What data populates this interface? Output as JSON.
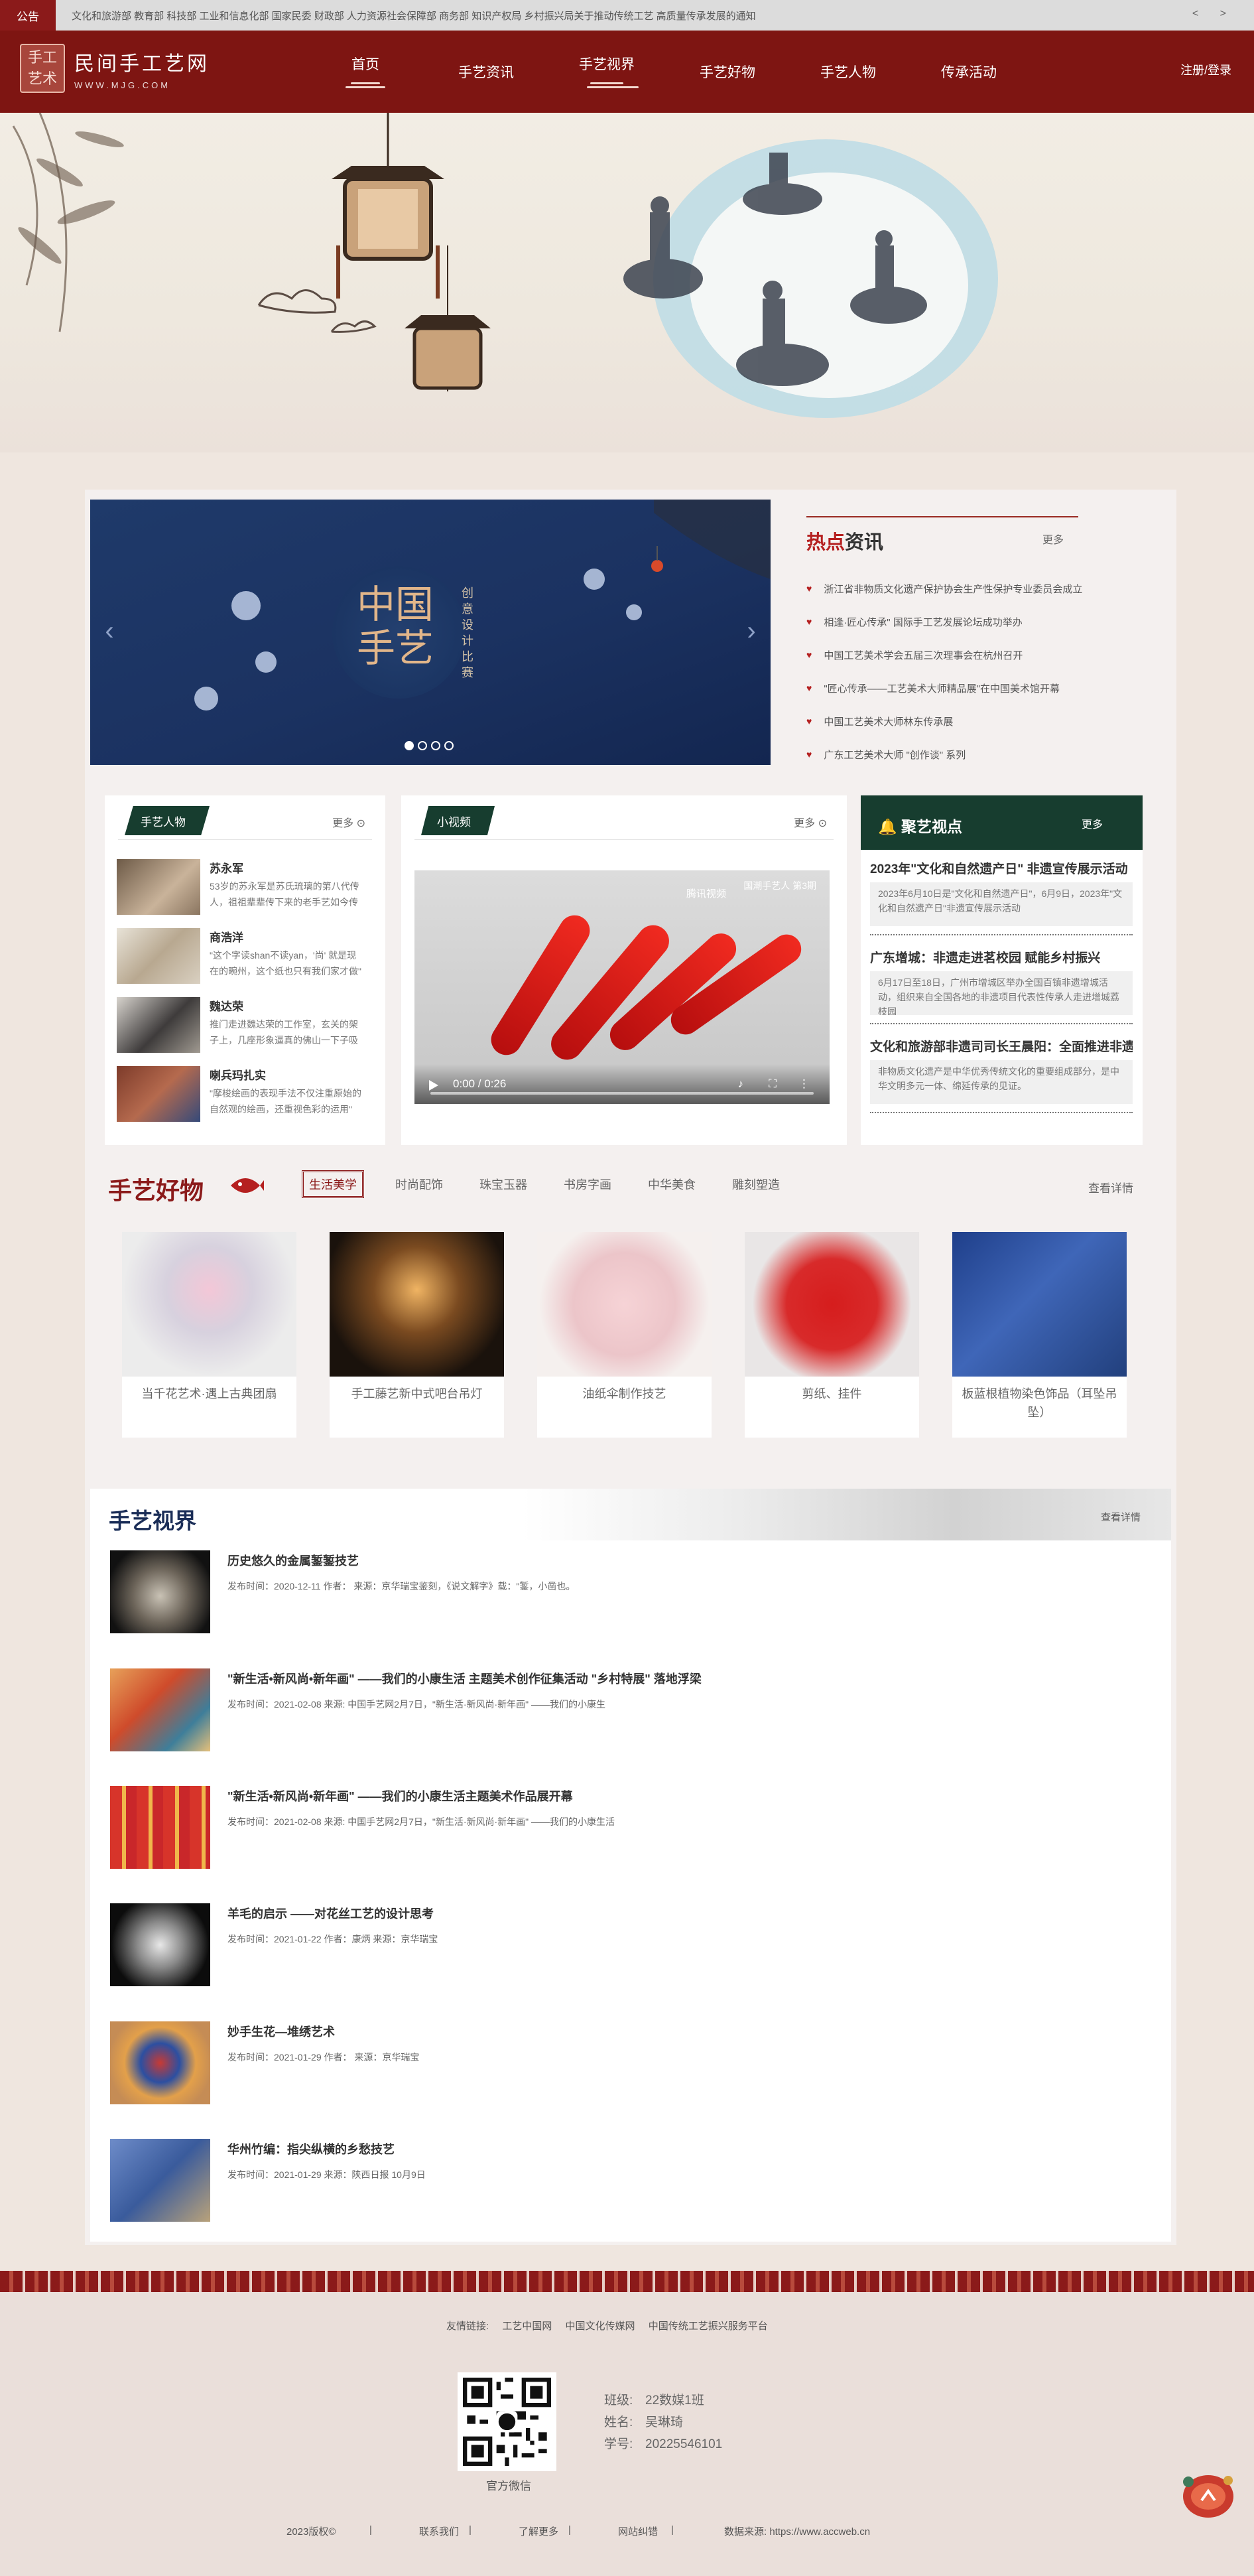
{
  "notice": {
    "tag": "公告",
    "text": "文化和旅游部 教育部 科技部 工业和信息化部 国家民委 财政部 人力资源社会保障部 商务部 知识产权局 乡村振兴局关于推动传统工艺 高质量传承发展的通知",
    "arrows": "< >"
  },
  "header": {
    "logo_seal": "手工 艺术",
    "logo_name": "民间手工艺网",
    "logo_url": "WWW.MJG.COM",
    "nav": [
      "首页",
      "手艺资讯",
      "手艺视界",
      "手艺好物",
      "手艺人物",
      "传承活动"
    ],
    "login": "注册/登录"
  },
  "banner": {
    "title": "中国手艺",
    "vertical": "创意设计比赛",
    "prev": "‹",
    "next": "›"
  },
  "hot": {
    "title_red": "热点",
    "title_rest": "资讯",
    "more": "更多",
    "items": [
      "浙江省非物质文化遗产保护协会生产性保护专业委员会成立",
      "相逢·匠心传承\" 国际手工艺发展论坛成功举办",
      "中国工艺美术学会五届三次理事会在杭州召开",
      "\"匠心传承——工艺美术大师精品展\"在中国美术馆开幕",
      "中国工艺美术大师林东传承展",
      "广东工艺美术大师 \"创作谈\" 系列"
    ]
  },
  "people": {
    "title": "手艺人物",
    "more": "更多",
    "items": [
      {
        "name": "苏永军",
        "desc": "53岁的苏永军是苏氏琉璃的第八代传人，祖祖辈辈传下来的老手艺如今传承到他的手里"
      },
      {
        "name": "商浩洋",
        "desc": "\"这个字读shan不读yan，'尚' 就是现在的畹州，这个纸也只有我们家才做\""
      },
      {
        "name": "魏达荣",
        "desc": "推门走进魏达荣的工作室，玄关的架子上，几座形象逼真的佛山一下子吸引住了目光"
      },
      {
        "name": "喇兵玛扎实",
        "desc": "\"摩梭绘画的表现手法不仅注重原始的自然观的绘画，还重视色彩的运用\""
      }
    ]
  },
  "video": {
    "title": "小视频",
    "more": "更多",
    "brand": "腾讯视频",
    "watermark": "国潮手艺人 第3期",
    "time": "0:00 / 0:26"
  },
  "focus": {
    "title": "聚艺视点",
    "more": "更多",
    "items": [
      {
        "title": "2023年\"文化和自然遗产日\" 非遗宣传展示活动",
        "desc": "2023年6月10日是\"文化和自然遗产日\"，6月9日，2023年\"文化和自然遗产日\"非遗宣传展示活动"
      },
      {
        "title": "广东增城：非遗走进茗校园 赋能乡村振兴",
        "desc": "6月17日至18日，广州市增城区举办全国百镇非遗增城活动，组织来自全国各地的非遗项目代表性传承人走进增城荔枝园"
      },
      {
        "title": "文化和旅游部非遗司司长王晨阳：全面推进非遗保护",
        "desc": "非物质文化遗产是中华优秀传统文化的重要组成部分，是中华文明多元一体、绵延传承的见证。"
      }
    ]
  },
  "goods": {
    "title": "手艺好物",
    "tabs": [
      "生活美学",
      "时尚配饰",
      "珠宝玉器",
      "书房字画",
      "中华美食",
      "雕刻塑造"
    ],
    "more": "查看详情",
    "items": [
      "当千花艺术·遇上古典团扇",
      "手工藤艺新中式吧台吊灯",
      "油纸伞制作技艺",
      "剪纸、挂件",
      "板蓝根植物染色饰品（耳坠吊坠）"
    ]
  },
  "vision": {
    "title": "手艺视界",
    "more": "查看详情",
    "items": [
      {
        "title": "历史悠久的金属錾錾技艺",
        "meta": "发布时间：2020-12-11 作者： 来源：京华瑞宝鉴刻，《说文解字》载：\"錾，小凿也。"
      },
      {
        "title": "\"新生活•新风尚•新年画\" ——我们的小康生活 主题美术创作征集活动 \"乡村特展\" 落地浮梁",
        "meta": "发布时间：2021-02-08 来源: 中国手艺网2月7日，\"新生活·新风尚·新年画\" ——我们的小康生"
      },
      {
        "title": "\"新生活•新风尚•新年画\" ——我们的小康生活主题美术作品展开幕",
        "meta": "发布时间：2021-02-08 来源: 中国手艺网2月7日，\"新生活·新风尚·新年画\" ——我们的小康生活"
      },
      {
        "title": "羊毛的启示 ——对花丝工艺的设计思考",
        "meta": "发布时间：2021-01-22 作者：康炳 来源：京华瑞宝"
      },
      {
        "title": "妙手生花—堆绣艺术",
        "meta": "发布时间：2021-01-29 作者： 来源：京华瑞宝"
      },
      {
        "title": "华州竹编：指尖纵横的乡愁技艺",
        "meta": "发布时间：2021-01-29 来源：陕西日报 10月9日"
      }
    ]
  },
  "footer": {
    "links_label": "友情链接:",
    "links": [
      "工艺中国网",
      "中国文化传媒网",
      "中国传统工艺振兴服务平台"
    ],
    "qr_caption": "官方微信",
    "class_label": "班级:",
    "class_value": "22数媒1班",
    "name_label": "姓名:",
    "name_value": "吴琳琦",
    "id_label": "学号:",
    "id_value": "20225546101",
    "bottom": [
      "2023版权©",
      "|",
      "联系我们",
      "|",
      "了解更多",
      "|",
      "网站纠错",
      "|",
      "数据来源: https://www.accweb.cn"
    ]
  },
  "colors": {
    "brand_red": "#7e1512",
    "accent_red": "#b52020",
    "dark_green": "#173d2f",
    "navy": "#1a2d57"
  }
}
